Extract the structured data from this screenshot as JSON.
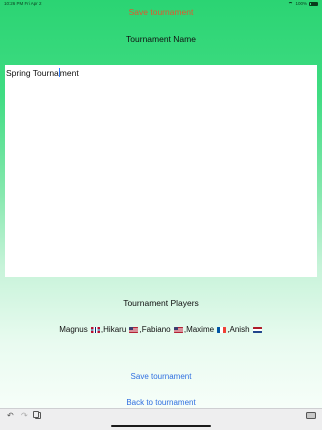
{
  "status_bar": {
    "time_date": "10:26 PM  Fri Apr 2",
    "battery": "100%"
  },
  "top_action": {
    "label": "Save tournament"
  },
  "tournament_name": {
    "title": "Tournament Name",
    "value_before_caret": "Spring Tourna",
    "value_after_caret": "ment"
  },
  "players": {
    "title": "Tournament Players",
    "list": [
      {
        "name": "Magnus",
        "flag": "norway-flag-icon"
      },
      {
        "name": "Hikaru",
        "flag": "usa-flag-icon"
      },
      {
        "name": "Fabiano",
        "flag": "usa-flag-icon"
      },
      {
        "name": "Maxime",
        "flag": "france-flag-icon"
      },
      {
        "name": "Anish",
        "flag": "netherlands-flag-icon"
      }
    ],
    "p0": "Magnus ",
    "p1": ",Hikaru ",
    "p2": ",Fabiano ",
    "p3": ",Maxime ",
    "p4": ",Anish "
  },
  "buttons": {
    "save": "Save tournament",
    "back": "Back to tournament"
  },
  "shortcut_bar": {
    "undo_glyph": "↶",
    "redo_glyph": "↷"
  },
  "colors": {
    "accent_link": "#2f6fe0",
    "top_action": "#e0582f",
    "gradient_top": "#2bd473"
  }
}
